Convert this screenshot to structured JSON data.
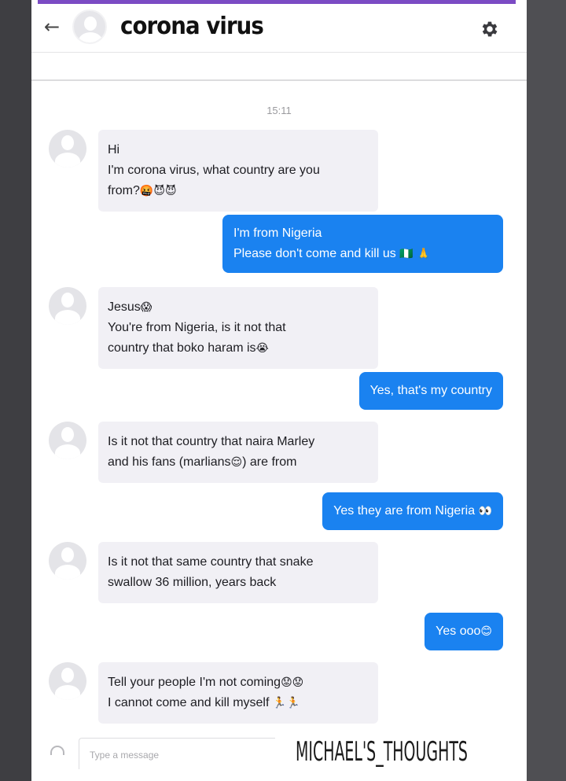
{
  "header": {
    "back_icon": "arrow-left-icon",
    "title": "corona virus",
    "settings_icon": "gear-icon"
  },
  "timestamp": "15:11",
  "messages": [
    {
      "side": "in",
      "lines": [
        "Hi",
        "I'm corona virus, what country are you",
        "from?"
      ],
      "emoji": [
        "🤬",
        "😈",
        "😈"
      ]
    },
    {
      "side": "out",
      "lines": [
        "I'm from Nigeria",
        "Please don't come and kill us"
      ],
      "emoji": [
        "🇳🇬",
        "🙏"
      ]
    },
    {
      "side": "in",
      "lines": [
        "Jesus",
        "You're from Nigeria, is it not that",
        "country that boko haram is"
      ],
      "emoji": [
        "😱",
        "😭"
      ]
    },
    {
      "side": "out",
      "lines": [
        "Yes, that's my country"
      ]
    },
    {
      "side": "in",
      "lines": [
        "Is it not that country that naira Marley",
        "and his fans (marlians",
        ") are from"
      ],
      "emoji": [
        "😌"
      ]
    },
    {
      "side": "out",
      "lines": [
        "Yes they are from Nigeria"
      ],
      "emoji": [
        "👀"
      ]
    },
    {
      "side": "in",
      "lines": [
        "Is it not that same country that snake",
        "swallow 36 million, years back"
      ]
    },
    {
      "side": "out",
      "lines": [
        "Yes ooo"
      ],
      "emoji": [
        "😊"
      ]
    },
    {
      "side": "in",
      "lines": [
        "Tell your people I'm not coming",
        "I cannot come and kill myself"
      ],
      "emoji": [
        "😟",
        "😟",
        "🏃",
        "🏃"
      ]
    }
  ],
  "composer": {
    "placeholder": "Type a message"
  },
  "watermark": "MICHAEL'S_THOUGHTS",
  "colors": {
    "accent_stripe": "#7b4bc4",
    "outgoing_bubble": "#1a82f0",
    "incoming_bubble": "#f1f0f5"
  }
}
